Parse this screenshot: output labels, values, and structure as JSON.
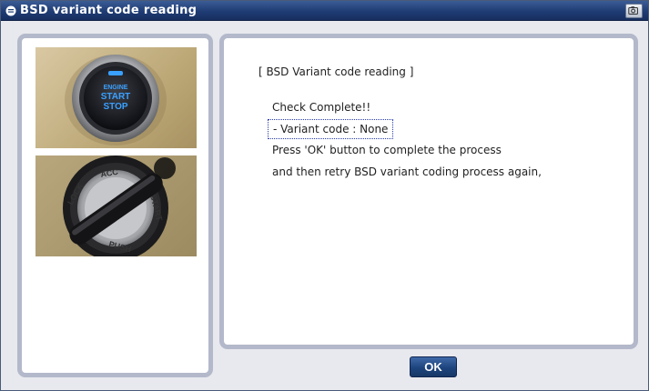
{
  "window": {
    "title": "BSD variant code reading"
  },
  "message": {
    "heading": "[ BSD Variant code reading ]",
    "status": "Check Complete!!",
    "variant": "- Variant code : None",
    "line_press": "Press 'OK' button to complete the process",
    "line_retry": "and then retry BSD variant coding process again,"
  },
  "images": {
    "start_button_text": [
      "ENGINE",
      "START",
      "STOP"
    ],
    "ignition_labels": [
      "LOCK",
      "ACC",
      "START",
      "PUSH"
    ]
  },
  "buttons": {
    "ok": "OK"
  },
  "colors": {
    "titlebar": "#1f3c74",
    "panel_border": "#b3b9ca",
    "ok_button": "#1d447e",
    "start_button_glow": "#3aa0ff"
  }
}
